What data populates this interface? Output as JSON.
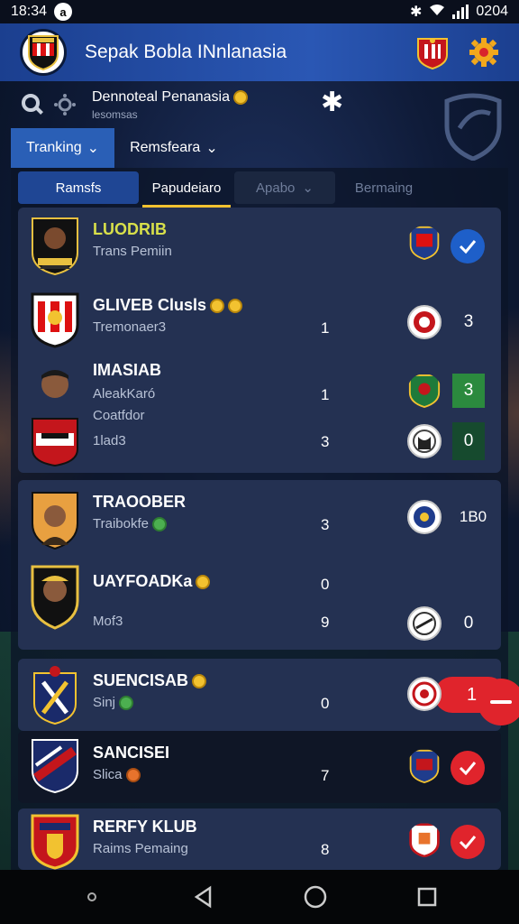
{
  "status_bar": {
    "time": "18:34",
    "notif": "a",
    "right_time": "0204"
  },
  "header": {
    "title": "Sepak Bobla INnlanasia"
  },
  "subbar": {
    "title": "Dennoteal Penanasia",
    "caption": "lesomsas"
  },
  "top_tabs": [
    {
      "label": "Tranking",
      "chevron": "⌄"
    },
    {
      "label": "Remsfeara",
      "chevron": "⌄"
    }
  ],
  "segments": [
    {
      "label": "Ramsfs"
    },
    {
      "label": "Papudeiaro"
    },
    {
      "label": "Apabo",
      "chevron": "⌄"
    },
    {
      "label": "Bermaing"
    }
  ],
  "cards": [
    {
      "rows": [
        {
          "name": "LUODRIB",
          "sub": "Trans Pemiin",
          "num": "",
          "right": "check-blue",
          "score": ""
        },
        {
          "name": "GLIVEB Clusls",
          "sub": "Tremonaer3",
          "num": "1",
          "right": "score",
          "score": "3"
        },
        {
          "name": "IMASIAB",
          "sub": "AleakKaró",
          "num": "1",
          "right": "score-green",
          "score": "3"
        },
        {
          "name": "Coatfdor",
          "sub": "1lad3",
          "num": "3",
          "right": "score-dark",
          "score": "0"
        }
      ]
    },
    {
      "rows": [
        {
          "name": "TRAOOBER",
          "sub": "Traibokfe",
          "num": "3",
          "right": "score",
          "score": "1B0"
        },
        {
          "name": "UAYFOADKa",
          "sub": "Mof3",
          "num_top": "0",
          "num": "9",
          "right": "score",
          "score": "0"
        }
      ]
    },
    {
      "rows": [
        {
          "name": "SUENCISAB",
          "sub": "Sinj",
          "num": "0",
          "right": "red-pill",
          "score": "1"
        }
      ]
    },
    {
      "rows": [
        {
          "name": "SANCISEI",
          "sub": "Slica",
          "num": "7",
          "right": "check-red",
          "score": ""
        }
      ]
    },
    {
      "rows": [
        {
          "name": "RERFY KLUB",
          "sub": "Raims Pemaing",
          "num": "8",
          "right": "check-red",
          "score": ""
        }
      ]
    }
  ],
  "colors": {
    "accent": "#2a5fb6",
    "gold": "#f2c230",
    "red": "#e0242c",
    "green": "#2b8a3e"
  },
  "icons": [
    "search-icon",
    "settings-icon",
    "gear-icon",
    "shield-icon",
    "check-icon",
    "back-icon",
    "home-icon",
    "recents-icon"
  ]
}
